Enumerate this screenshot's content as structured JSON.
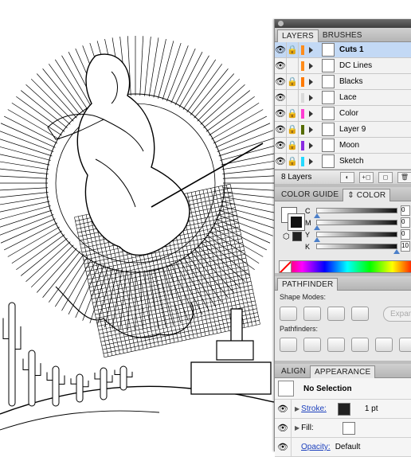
{
  "panels": {
    "layers_tab": "LAYERS",
    "brushes_tab": "BRUSHES",
    "layers": [
      {
        "name": "Cuts 1",
        "color": "#ff8c1a",
        "selected": true
      },
      {
        "name": "DC Lines",
        "color": "#ff8c1a"
      },
      {
        "name": "Blacks",
        "color": "#ff7a00"
      },
      {
        "name": "Lace",
        "color": "#d9d9d9"
      },
      {
        "name": "Color",
        "color": "#ff3dd2"
      },
      {
        "name": "Layer 9",
        "color": "#556b00"
      },
      {
        "name": "Moon",
        "color": "#8a2be2"
      },
      {
        "name": "Sketch",
        "color": "#25d9ff"
      }
    ],
    "layers_count": "8 Layers",
    "color_guide_tab": "COLOR GUIDE",
    "color_tab": "COLOR",
    "cmyk": [
      {
        "label": "C",
        "value": "0"
      },
      {
        "label": "M",
        "value": "0"
      },
      {
        "label": "Y",
        "value": "0"
      },
      {
        "label": "K",
        "value": "10"
      }
    ],
    "pathfinder_tab": "PATHFINDER",
    "shape_modes_label": "Shape Modes:",
    "expand_label": "Expan",
    "pathfinders_label": "Pathfinders:",
    "align_tab": "ALIGN",
    "appearance_tab": "APPEARANCE",
    "no_selection": "No Selection",
    "stroke_label": "Stroke:",
    "stroke_value": "1 pt",
    "fill_label": "Fill:",
    "opacity_label": "Opacity:",
    "opacity_value": "Default"
  }
}
